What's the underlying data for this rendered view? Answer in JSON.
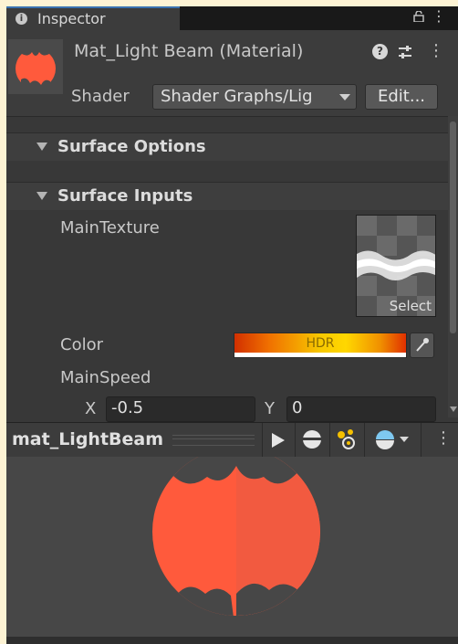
{
  "tab": {
    "label": "Inspector",
    "icon": "info-icon",
    "lock_icon": "lock-icon",
    "menu_icon": "kebab-menu-icon"
  },
  "header": {
    "title": "Mat_Light Beam (Material)",
    "help_icon": "help-icon",
    "presets_icon": "presets-icon",
    "menu_icon": "kebab-menu-icon",
    "shader_label": "Shader",
    "shader_value": "Shader Graphs/Lig",
    "edit_label": "Edit..."
  },
  "sections": {
    "surface_options": "Surface Options",
    "surface_inputs": "Surface Inputs"
  },
  "properties": {
    "main_texture_label": "MainTexture",
    "texture_select": "Select",
    "color_label": "Color",
    "color_hdr": "HDR",
    "main_speed_label": "MainSpeed",
    "x_label": "X",
    "x_value": "-0.5",
    "y_label": "Y",
    "y_value": "0"
  },
  "preview": {
    "title": "mat_LightBeam",
    "play_icon": "play-icon",
    "sphere_icon": "sphere-mesh-icon",
    "lights_icon": "lights-icon",
    "background_icon": "background-sphere-icon",
    "menu_icon": "kebab-menu-icon"
  },
  "colors": {
    "material_orange": "#ff5a3c",
    "panel_bg": "#383838",
    "accent_blue": "#3a72b0",
    "hdr_yellow": "#ffd700"
  }
}
